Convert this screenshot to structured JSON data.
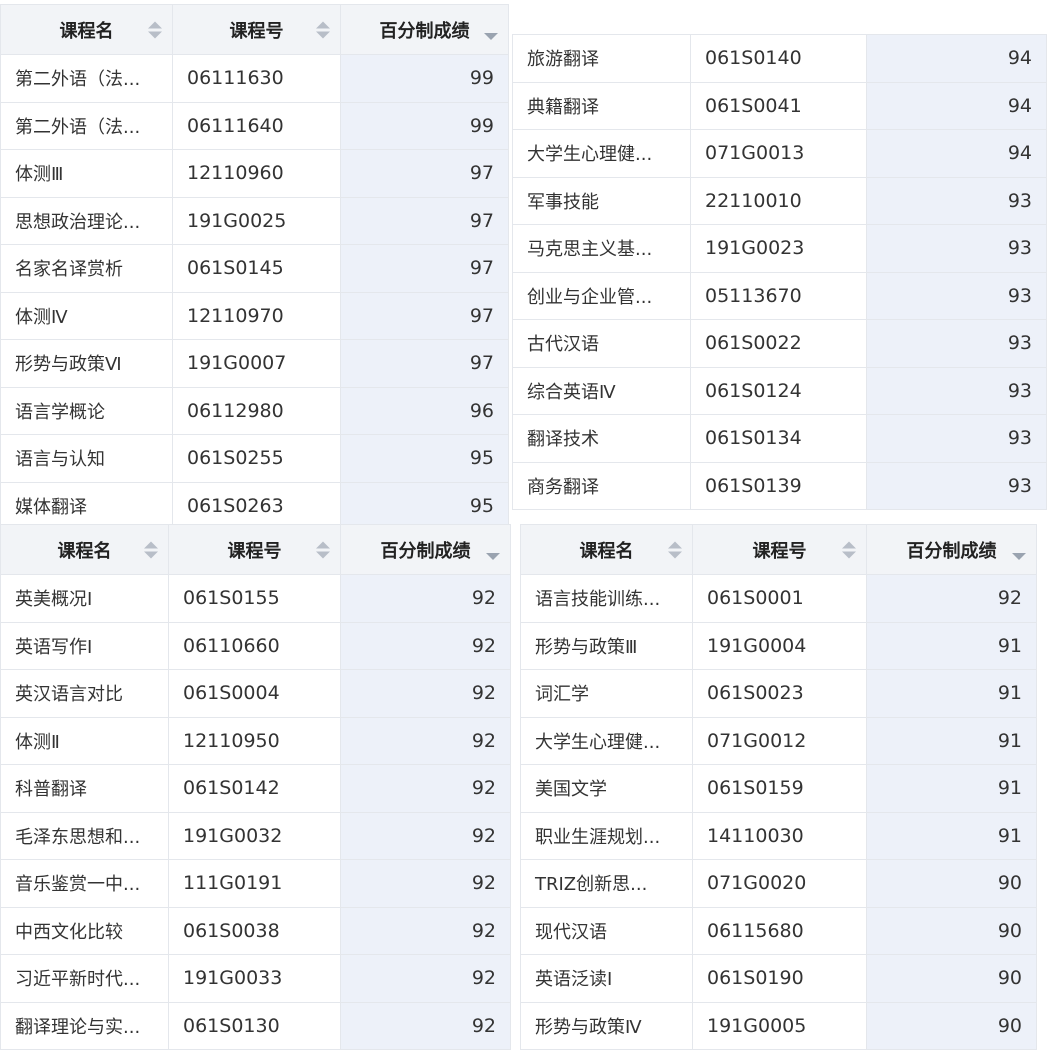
{
  "headers": {
    "name": "课程名",
    "code": "课程号",
    "score": "百分制成绩"
  },
  "tables": [
    {
      "rows": [
        [
          "第二外语（法...",
          "06111630",
          "99"
        ],
        [
          "第二外语（法...",
          "06111640",
          "99"
        ],
        [
          "体测Ⅲ",
          "12110960",
          "97"
        ],
        [
          "思想政治理论...",
          "191G0025",
          "97"
        ],
        [
          "名家名译赏析",
          "061S0145",
          "97"
        ],
        [
          "体测Ⅳ",
          "12110970",
          "97"
        ],
        [
          "形势与政策Ⅵ",
          "191G0007",
          "97"
        ],
        [
          "语言学概论",
          "06112980",
          "96"
        ],
        [
          "语言与认知",
          "061S0255",
          "95"
        ],
        [
          "媒体翻译",
          "061S0263",
          "95"
        ]
      ]
    },
    {
      "rows": [
        [
          "旅游翻译",
          "061S0140",
          "94"
        ],
        [
          "典籍翻译",
          "061S0041",
          "94"
        ],
        [
          "大学生心理健...",
          "071G0013",
          "94"
        ],
        [
          "军事技能",
          "22110010",
          "93"
        ],
        [
          "马克思主义基...",
          "191G0023",
          "93"
        ],
        [
          "创业与企业管...",
          "05113670",
          "93"
        ],
        [
          "古代汉语",
          "061S0022",
          "93"
        ],
        [
          "综合英语Ⅳ",
          "061S0124",
          "93"
        ],
        [
          "翻译技术",
          "061S0134",
          "93"
        ],
        [
          "商务翻译",
          "061S0139",
          "93"
        ]
      ]
    },
    {
      "rows": [
        [
          "英美概况Ⅰ",
          "061S0155",
          "92"
        ],
        [
          "英语写作Ⅰ",
          "06110660",
          "92"
        ],
        [
          "英汉语言对比",
          "061S0004",
          "92"
        ],
        [
          "体测Ⅱ",
          "12110950",
          "92"
        ],
        [
          "科普翻译",
          "061S0142",
          "92"
        ],
        [
          "毛泽东思想和...",
          "191G0032",
          "92"
        ],
        [
          "音乐鉴赏一中...",
          "111G0191",
          "92"
        ],
        [
          "中西文化比较",
          "061S0038",
          "92"
        ],
        [
          "习近平新时代...",
          "191G0033",
          "92"
        ],
        [
          "翻译理论与实...",
          "061S0130",
          "92"
        ]
      ]
    },
    {
      "rows": [
        [
          "语言技能训练...",
          "061S0001",
          "92"
        ],
        [
          "形势与政策Ⅲ",
          "191G0004",
          "91"
        ],
        [
          "词汇学",
          "061S0023",
          "91"
        ],
        [
          "大学生心理健...",
          "071G0012",
          "91"
        ],
        [
          "美国文学",
          "061S0159",
          "91"
        ],
        [
          "职业生涯规划...",
          "14110030",
          "91"
        ],
        [
          "TRIZ创新思...",
          "071G0020",
          "90"
        ],
        [
          "现代汉语",
          "06115680",
          "90"
        ],
        [
          "英语泛读Ⅰ",
          "061S0190",
          "90"
        ],
        [
          "形势与政策Ⅳ",
          "191G0005",
          "90"
        ]
      ]
    }
  ]
}
